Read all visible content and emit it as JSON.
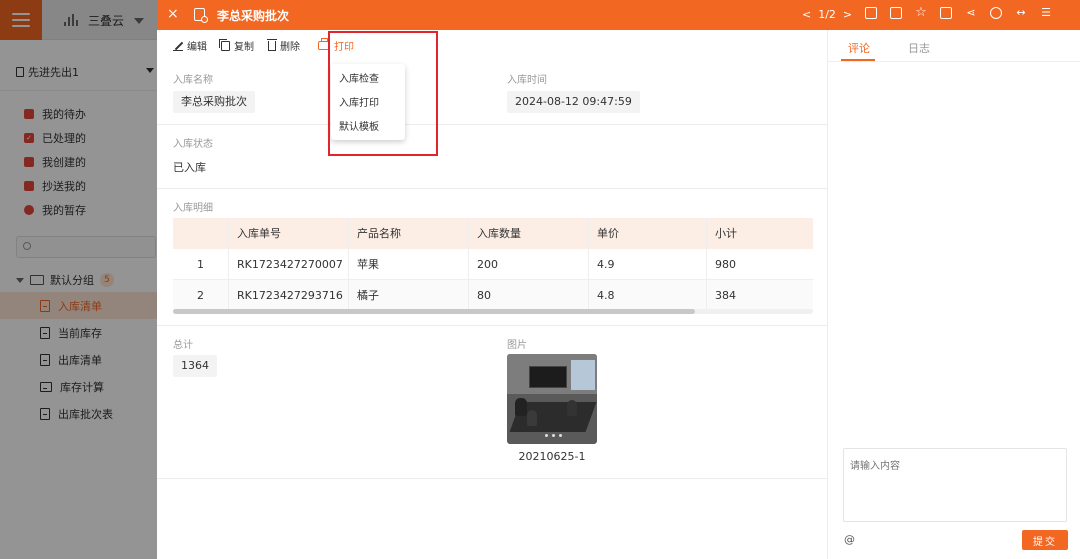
{
  "app": {
    "brand_name": "三叠云",
    "workspace": "先进先出1"
  },
  "sidebar": {
    "todo_items": [
      {
        "label": "我的待办",
        "color": "#e2473b"
      },
      {
        "label": "已处理的",
        "color": "#e2473b"
      },
      {
        "label": "我创建的",
        "color": "#e2473b"
      },
      {
        "label": "抄送我的",
        "color": "#e2473b"
      },
      {
        "label": "我的暂存",
        "color": "#e2473b"
      }
    ],
    "group": {
      "label": "默认分组",
      "count": "5"
    },
    "nav_items": [
      {
        "label": "入库清单",
        "active": true
      },
      {
        "label": "当前库存",
        "active": false
      },
      {
        "label": "出库清单",
        "active": false
      },
      {
        "label": "库存计算",
        "active": false
      },
      {
        "label": "出库批次表",
        "active": false
      }
    ]
  },
  "modal": {
    "title": "李总采购批次",
    "pager": {
      "prev": "<",
      "current": "1/2",
      "next": ">"
    },
    "toolbar": {
      "edit": "编辑",
      "copy": "复制",
      "delete": "删除",
      "print": "打印"
    },
    "print_menu": [
      "入库检查",
      "入库打印",
      "默认模板"
    ],
    "fields": {
      "name_label": "入库名称",
      "name_value": "李总采购批次",
      "time_label": "入库时间",
      "time_value": "2024-08-12 09:47:59",
      "status_label": "入库状态",
      "status_value": "已入库",
      "detail_label": "入库明细",
      "total_label": "总计",
      "total_value": "1364",
      "image_label": "图片",
      "image_caption": "20210625-1"
    },
    "table": {
      "headers": [
        "",
        "入库单号",
        "产品名称",
        "入库数量",
        "单价",
        "小计"
      ],
      "rows": [
        [
          "1",
          "RK1723427270007",
          "苹果",
          "200",
          "4.9",
          "980"
        ],
        [
          "2",
          "RK1723427293716",
          "橘子",
          "80",
          "4.8",
          "384"
        ]
      ]
    }
  },
  "right_panel": {
    "tabs": [
      "评论",
      "日志"
    ],
    "comment_placeholder": "请输入内容",
    "at_symbol": "@",
    "submit": "提交"
  },
  "colors": {
    "accent": "#f26722",
    "highlight": "#e0262b"
  }
}
